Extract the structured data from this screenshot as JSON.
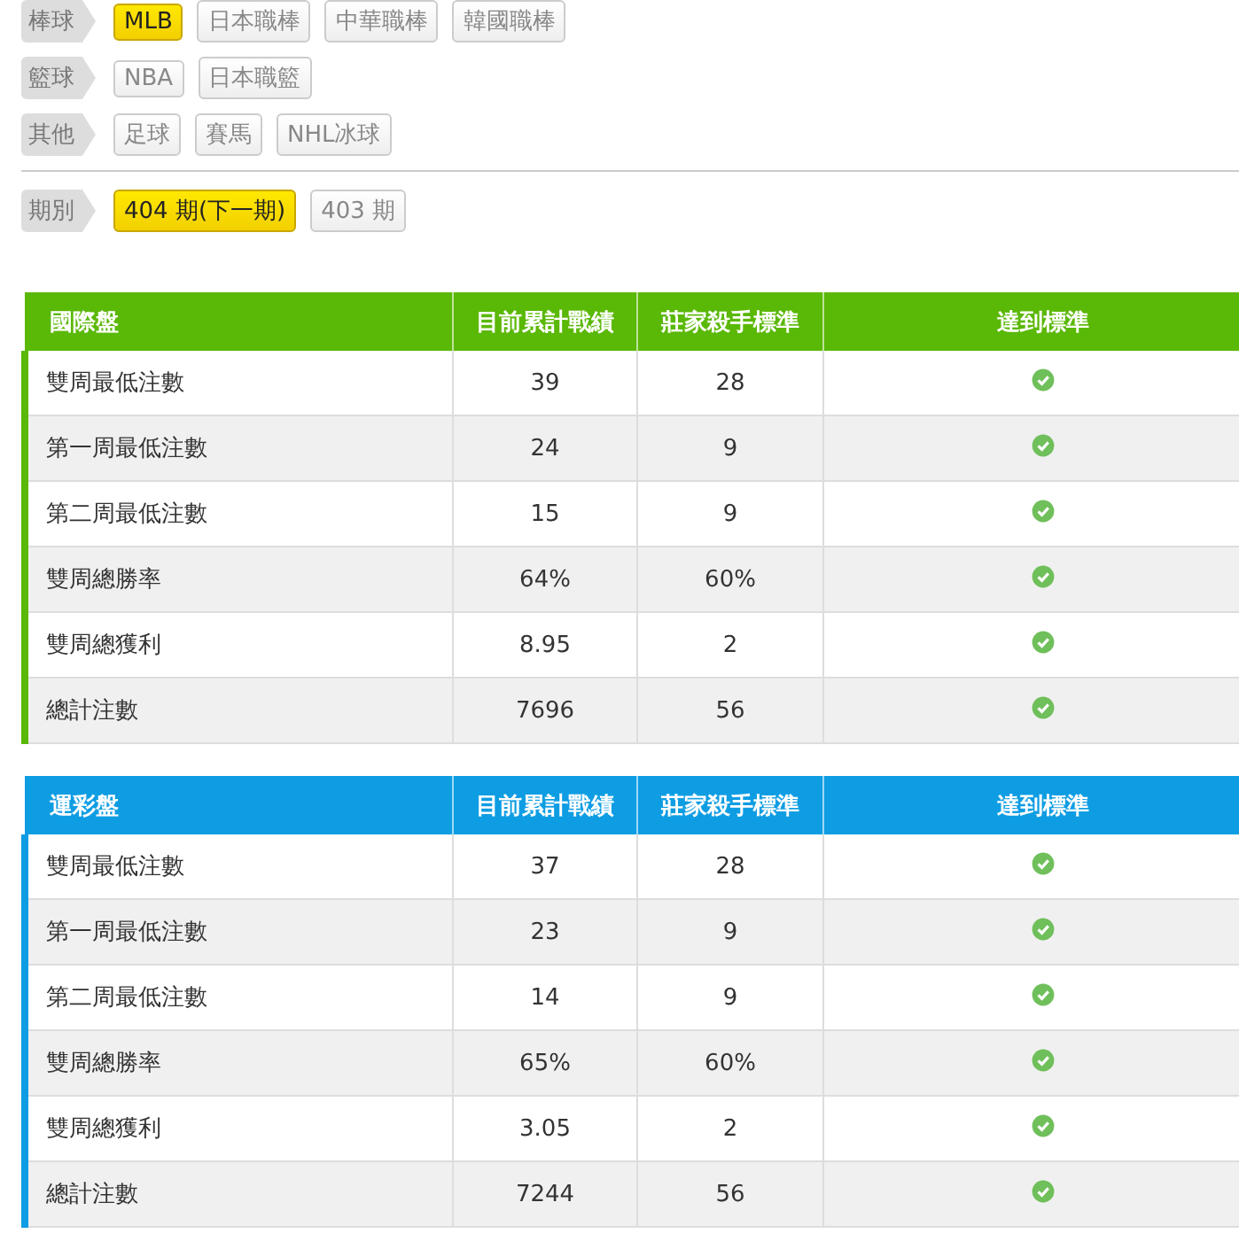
{
  "filters": [
    {
      "label": "棒球",
      "options": [
        {
          "text": "MLB",
          "selected": true
        },
        {
          "text": "日本職棒",
          "selected": false
        },
        {
          "text": "中華職棒",
          "selected": false
        },
        {
          "text": "韓國職棒",
          "selected": false
        }
      ]
    },
    {
      "label": "籃球",
      "options": [
        {
          "text": "NBA",
          "selected": false
        },
        {
          "text": "日本職籃",
          "selected": false
        }
      ]
    },
    {
      "label": "其他",
      "options": [
        {
          "text": "足球",
          "selected": false
        },
        {
          "text": "賽馬",
          "selected": false
        },
        {
          "text": "NHL冰球",
          "selected": false
        }
      ]
    }
  ],
  "period": {
    "label": "期別",
    "options": [
      {
        "text": "404 期(下一期)",
        "selected": true
      },
      {
        "text": "403 期",
        "selected": false
      }
    ]
  },
  "tables": [
    {
      "color": "#5ab806",
      "columns": [
        "國際盤",
        "目前累計戰績",
        "莊家殺手標準",
        "達到標準"
      ],
      "rows": [
        {
          "name": "雙周最低注數",
          "current": "39",
          "standard": "28",
          "reached": true
        },
        {
          "name": "第一周最低注數",
          "current": "24",
          "standard": "9",
          "reached": true
        },
        {
          "name": "第二周最低注數",
          "current": "15",
          "standard": "9",
          "reached": true
        },
        {
          "name": "雙周總勝率",
          "current": "64%",
          "standard": "60%",
          "reached": true
        },
        {
          "name": "雙周總獲利",
          "current": "8.95",
          "standard": "2",
          "reached": true
        },
        {
          "name": "總計注數",
          "current": "7696",
          "standard": "56",
          "reached": true
        }
      ]
    },
    {
      "color": "#0e9de3",
      "columns": [
        "運彩盤",
        "目前累計戰績",
        "莊家殺手標準",
        "達到標準"
      ],
      "rows": [
        {
          "name": "雙周最低注數",
          "current": "37",
          "standard": "28",
          "reached": true
        },
        {
          "name": "第一周最低注數",
          "current": "23",
          "standard": "9",
          "reached": true
        },
        {
          "name": "第二周最低注數",
          "current": "14",
          "standard": "9",
          "reached": true
        },
        {
          "name": "雙周總勝率",
          "current": "65%",
          "standard": "60%",
          "reached": true
        },
        {
          "name": "雙周總獲利",
          "current": "3.05",
          "standard": "2",
          "reached": true
        },
        {
          "name": "總計注數",
          "current": "7244",
          "standard": "56",
          "reached": true
        }
      ]
    }
  ]
}
